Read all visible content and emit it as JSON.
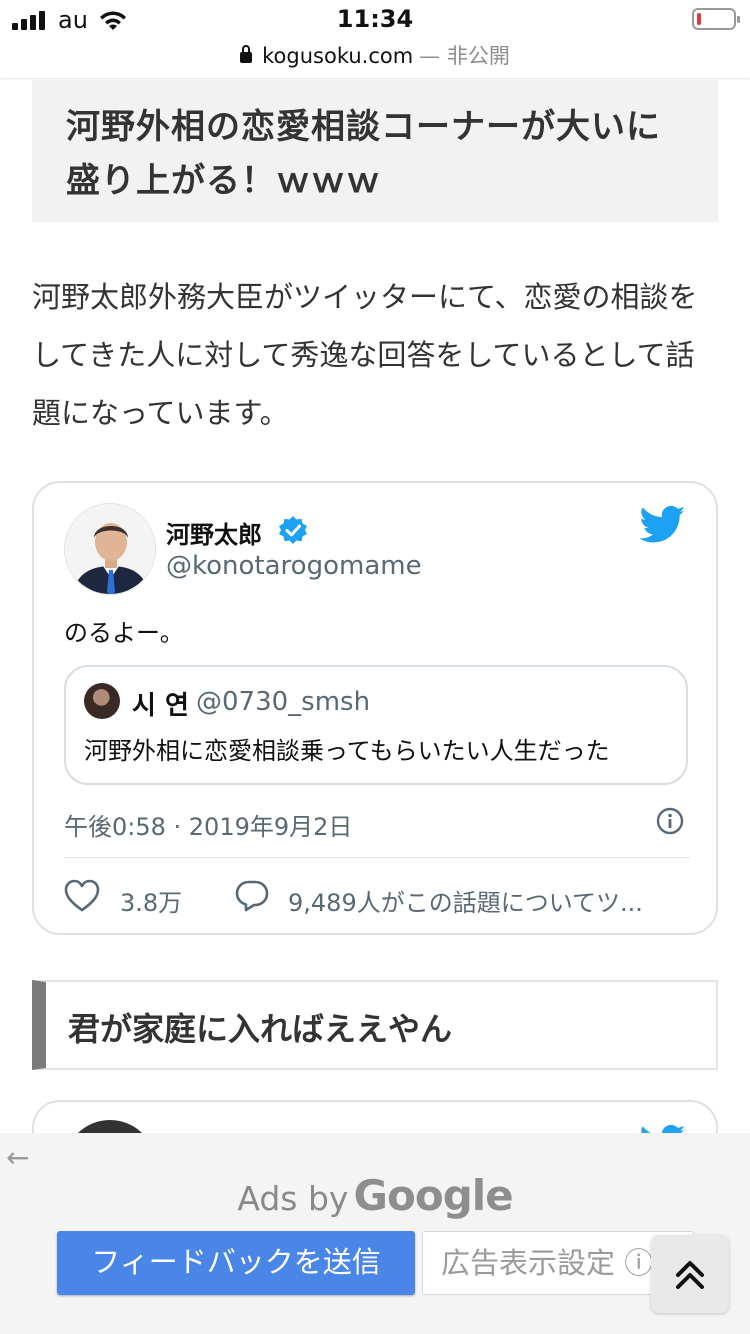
{
  "status_bar": {
    "carrier": "au",
    "time": "11:34",
    "battery_level": 0.1,
    "battery_color": "#e53935"
  },
  "url_bar": {
    "domain": "kogusoku.com",
    "suffix": "— 非公開"
  },
  "article": {
    "heading": "河野外相の恋愛相談コーナーが大いに盛り上がる！ｗｗｗ",
    "lead": "河野太郎外務大臣がツイッターにて、恋愛の相談をしてきた人に対して秀逸な回答をしているとして話題になっています。",
    "subheading": "君が家庭に入ればええやん"
  },
  "tweet": {
    "author_name": "河野太郎",
    "author_handle": "@konotarogomame",
    "verified": true,
    "text": "のるよー。",
    "quoted": {
      "name": "시 연",
      "handle": "@0730_smsh",
      "text": "河野外相に恋愛相談乗ってもらいたい人生だった"
    },
    "timestamp": "午後0:58 · 2019年9月2日",
    "likes": "3.8万",
    "replies": "9,489人がこの話題についてツ...",
    "bird_color": "#1da1f2",
    "verified_color": "#1da1f2"
  },
  "ad_panel": {
    "ads_by": "Ads by",
    "google": "Google",
    "feedback_label": "フィードバックを送信",
    "settings_label": "広告表示設定 ⓘ",
    "feedback_color": "#4a86e8"
  },
  "icons": {
    "lock": "lock-icon",
    "verified": "verified-badge-icon",
    "twitter": "twitter-bird-icon",
    "info": "info-icon",
    "heart": "heart-icon",
    "reply": "reply-bubble-icon",
    "back": "back-arrow-icon",
    "scroll_top": "double-chevron-up-icon"
  }
}
